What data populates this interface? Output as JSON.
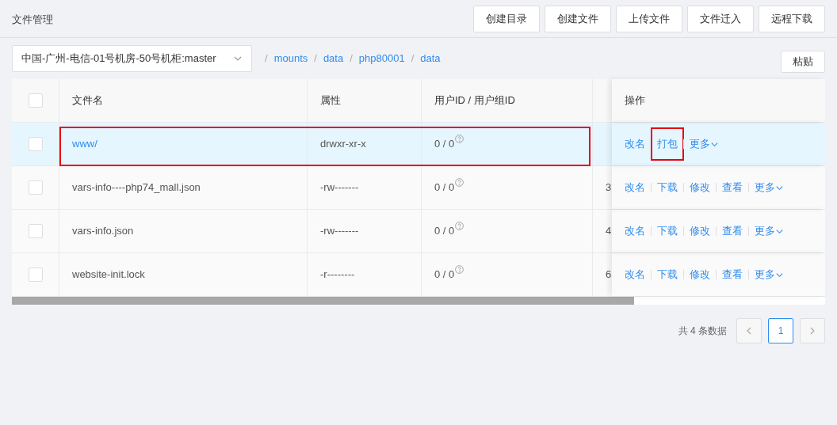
{
  "page_title": "文件管理",
  "toolbar_buttons": [
    "创建目录",
    "创建文件",
    "上传文件",
    "文件迁入",
    "远程下载"
  ],
  "server_select": {
    "value": "中国-广州-电信-01号机房-50号机柜:master"
  },
  "breadcrumb": [
    {
      "separator": "/",
      "label": "mounts"
    },
    {
      "separator": "/",
      "label": "data"
    },
    {
      "separator": "/",
      "label": "php80001"
    },
    {
      "separator": "/",
      "label": "data"
    }
  ],
  "select_all_checked": false,
  "paste_button": "粘贴",
  "table": {
    "columns": [
      "文件名",
      "属性",
      "用户ID / 用户组ID"
    ],
    "action_column": "操作",
    "rows": [
      {
        "name": "www/",
        "kind": "folder",
        "checked": false,
        "hovered": true,
        "highlighted": true,
        "attributes": "drwxr-xr-x",
        "owner": "0 / 0",
        "actions": [
          {
            "label": "改名",
            "highlighted": false
          },
          {
            "label": "打包",
            "highlighted": true
          },
          {
            "label": "更多",
            "kind": "menu",
            "highlighted": false
          }
        ]
      },
      {
        "name": "vars-info----php74_mall.json",
        "kind": "file",
        "checked": false,
        "hovered": false,
        "highlighted": false,
        "attributes": "-rw-------",
        "owner": "0 / 0",
        "column_5": "3",
        "actions": [
          {
            "label": "改名",
            "highlighted": false
          },
          {
            "label": "下载",
            "highlighted": false
          },
          {
            "label": "修改",
            "highlighted": false
          },
          {
            "label": "查看",
            "highlighted": false
          },
          {
            "label": "更多",
            "kind": "menu",
            "highlighted": false
          }
        ]
      },
      {
        "name": "vars-info.json",
        "kind": "file",
        "checked": false,
        "hovered": false,
        "highlighted": false,
        "attributes": "-rw-------",
        "owner": "0 / 0",
        "column_5": "4",
        "actions": [
          {
            "label": "改名",
            "highlighted": false
          },
          {
            "label": "下载",
            "highlighted": false
          },
          {
            "label": "修改",
            "highlighted": false
          },
          {
            "label": "查看",
            "highlighted": false
          },
          {
            "label": "更多",
            "kind": "menu",
            "highlighted": false
          }
        ]
      },
      {
        "name": "website-init.lock",
        "kind": "file",
        "checked": false,
        "hovered": false,
        "highlighted": false,
        "attributes": "-r--------",
        "owner": "0 / 0",
        "column_5": "6",
        "actions": [
          {
            "label": "改名",
            "highlighted": false
          },
          {
            "label": "下载",
            "highlighted": false
          },
          {
            "label": "修改",
            "highlighted": false
          },
          {
            "label": "查看",
            "highlighted": false
          },
          {
            "label": "更多",
            "kind": "menu",
            "highlighted": false
          }
        ]
      }
    ]
  },
  "pagination": {
    "total": "共 4 条数据",
    "pages": [
      {
        "label": "1",
        "selected": true
      }
    ]
  }
}
